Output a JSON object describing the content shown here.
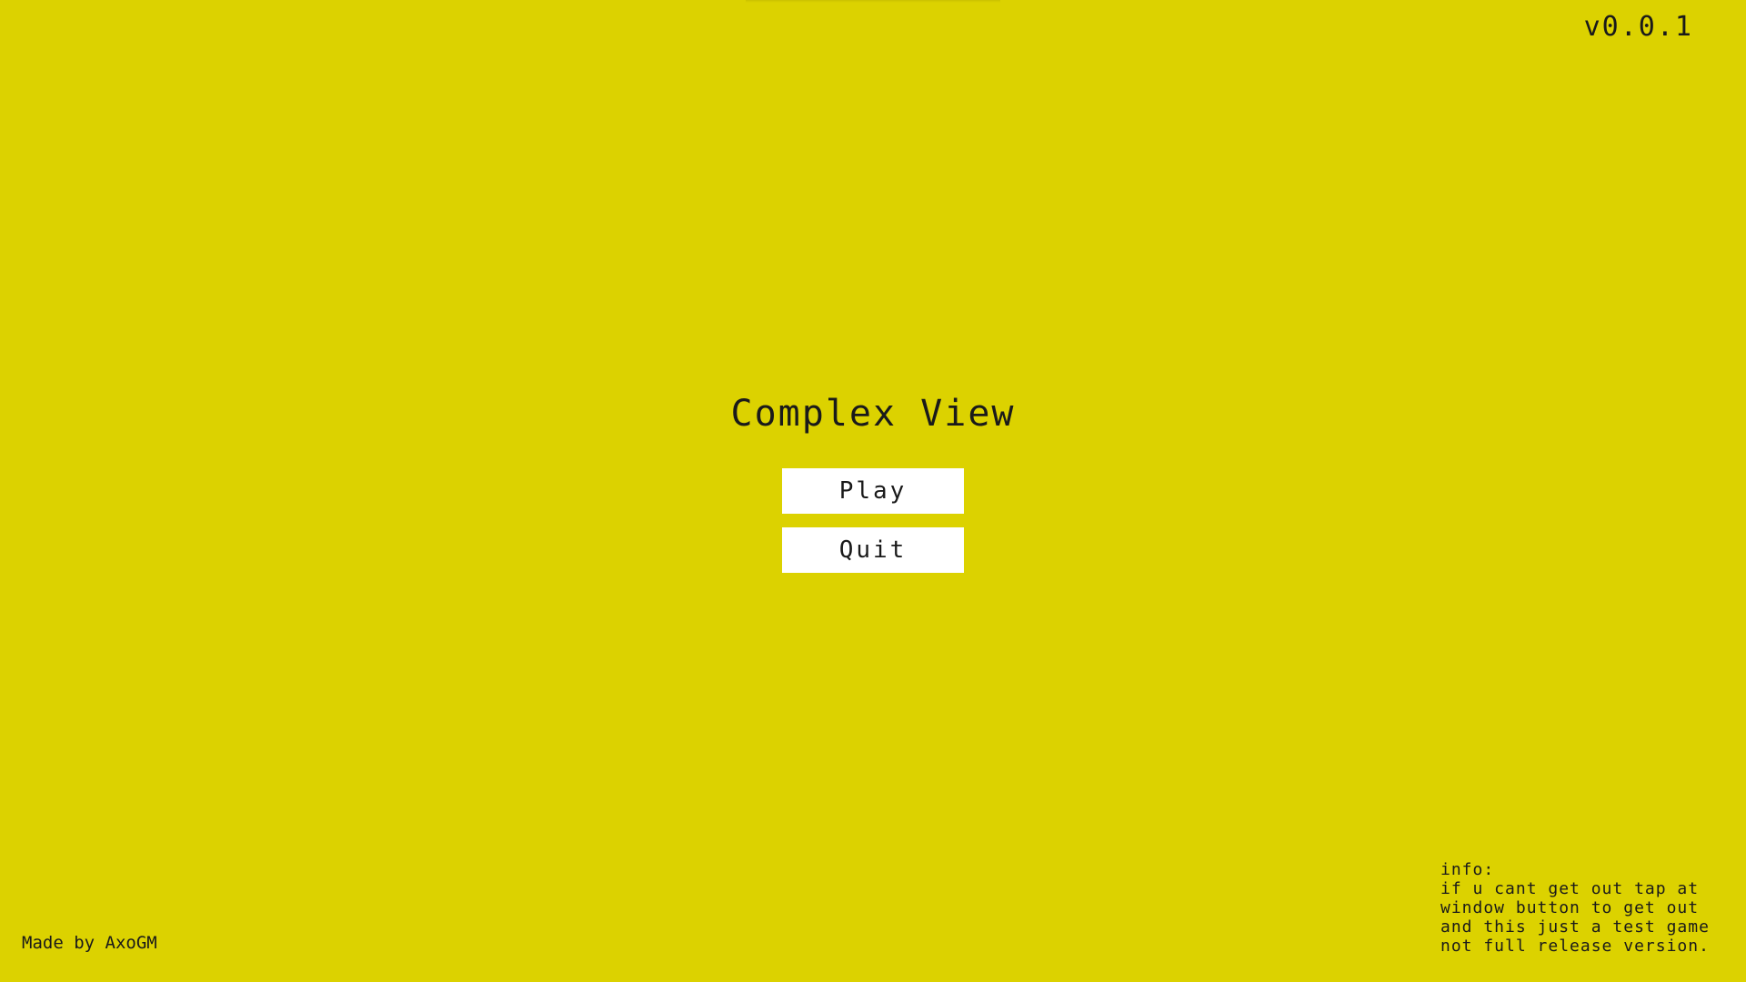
{
  "game": {
    "version": "v0.0.1",
    "title": "Complex View"
  },
  "menu": {
    "play_label": "Play",
    "quit_label": "Quit"
  },
  "footer": {
    "credit": "Made by AxoGM"
  },
  "info": {
    "heading": "info:",
    "lines": [
      "if u cant get out tap at",
      "window button to get out",
      "and this just a test game",
      "not full release version."
    ]
  },
  "colors": {
    "background": "#dcd200",
    "button": "#ffffff",
    "text": "#1a1a1a"
  }
}
